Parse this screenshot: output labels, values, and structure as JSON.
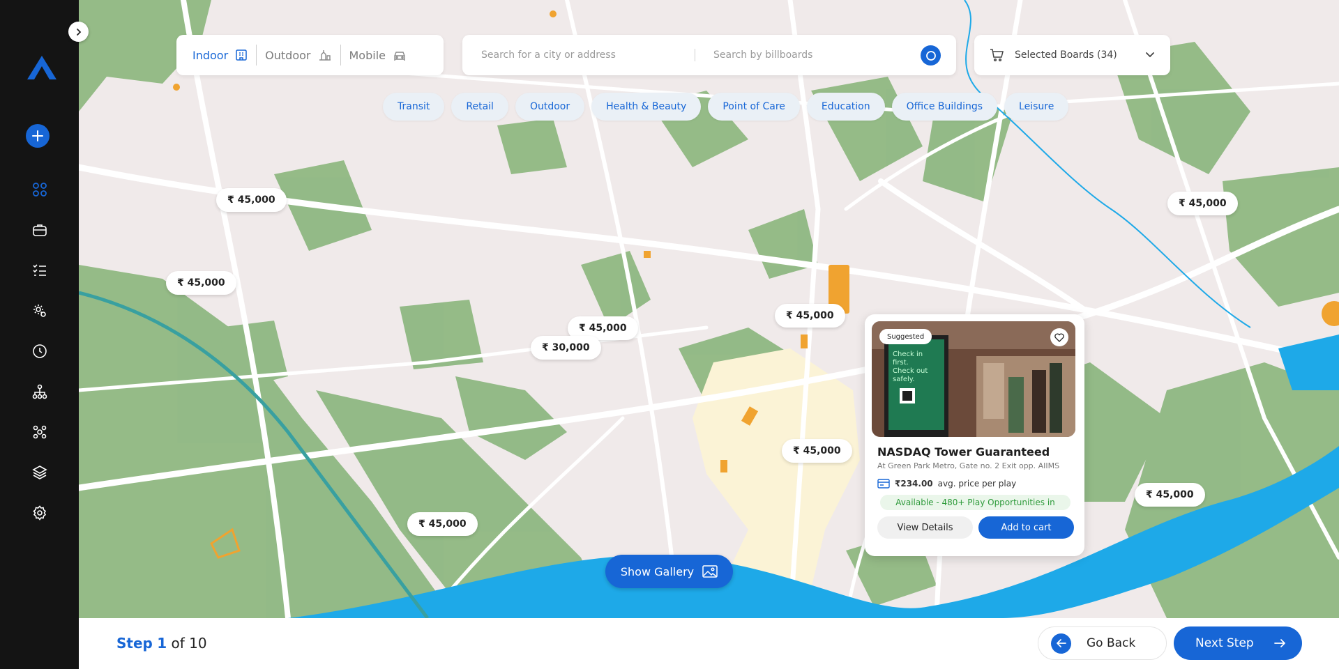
{
  "colors": {
    "accent": "#1766d6",
    "sidebar": "#141414",
    "park": "#8fb882",
    "water": "#1ea9e8",
    "road": "#ffffff",
    "available": "#2d9a3a"
  },
  "sidebar": {
    "logo": "logo-icon",
    "add": "plus-icon",
    "items": [
      "grid-icon",
      "briefcase-icon",
      "checklist-icon",
      "cog-multi-icon",
      "clock-icon",
      "hierarchy-icon",
      "network-icon",
      "layers-icon",
      "settings-icon"
    ]
  },
  "type_toggle": {
    "options": [
      {
        "label": "Indoor",
        "icon": "building-icon",
        "active": true
      },
      {
        "label": "Outdoor",
        "icon": "outdoor-icon",
        "active": false
      },
      {
        "label": "Mobile",
        "icon": "car-icon",
        "active": false
      }
    ]
  },
  "search": {
    "city_placeholder": "Search for a city or address",
    "billboard_placeholder": "Search by billboards"
  },
  "boards": {
    "label": "Selected Boards (34)"
  },
  "categories": [
    "Transit",
    "Retail",
    "Outdoor",
    "Health & Beauty",
    "Point of Care",
    "Education",
    "Office Buildings",
    "Leisure"
  ],
  "price_tags": [
    "₹ 45,000",
    "₹ 45,000",
    "₹ 45,000",
    "₹ 30,000",
    "₹ 45,000",
    "₹ 45,000",
    "₹ 45,000",
    "₹ 45,000",
    "₹ 45,000"
  ],
  "card": {
    "badge": "Suggested",
    "title": "NASDAQ Tower Guaranteed",
    "subtitle": "At Green Park Metro, Gate no. 2 Exit opp. AIIMS",
    "price": "₹234.00",
    "price_suffix": "avg. price per play",
    "availability": "Available - 480+ Play Opportunities in",
    "details_label": "View Details",
    "cart_label": "Add to cart",
    "screen_text": "Check in first. Check out safely."
  },
  "gallery": {
    "label": "Show Gallery"
  },
  "footer": {
    "step_word": "Step",
    "step_current": "1",
    "step_total": "of 10",
    "back_label": "Go Back",
    "next_label": "Next Step"
  }
}
